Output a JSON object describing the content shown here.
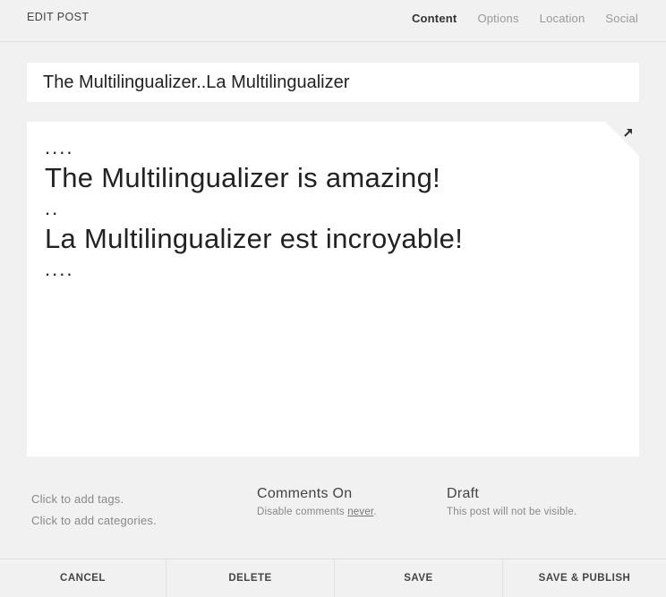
{
  "header": {
    "title": "EDIT POST",
    "tabs": [
      {
        "label": "Content",
        "active": true
      },
      {
        "label": "Options",
        "active": false
      },
      {
        "label": "Location",
        "active": false
      },
      {
        "label": "Social",
        "active": false
      }
    ]
  },
  "post": {
    "title_value": "The Multilingualizer..La Multilingualizer",
    "body_lines": [
      "....",
      "The Multilingualizer is amazing!",
      "..",
      "La Multilingualizer est incroyable!",
      "...."
    ],
    "expand_icon": "expand-arrow-icon"
  },
  "meta": {
    "tags_prompt": "Click to add tags.",
    "categories_prompt": "Click to add categories.",
    "comments": {
      "heading": "Comments On",
      "sub_prefix": "Disable comments ",
      "sub_link": "never",
      "sub_suffix": "."
    },
    "status": {
      "heading": "Draft",
      "sub": "This post will not be visible."
    }
  },
  "footer": {
    "cancel": "CANCEL",
    "delete": "DELETE",
    "save": "SAVE",
    "save_publish": "SAVE & PUBLISH"
  }
}
